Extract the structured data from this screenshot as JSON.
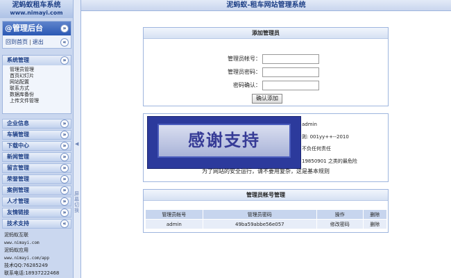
{
  "sidebar": {
    "logo_title": "泥蚂蚁租车系统",
    "logo_url": "www.nimayi.com",
    "admin_title": "@管理后台",
    "home_link": "回到首页",
    "logout_link": "退出",
    "system_group": {
      "label": "系统管理",
      "items": [
        "管理员管理",
        "首页幻灯片",
        "网站配置",
        "联系方式",
        "数据库备份",
        "上传文件管理"
      ]
    },
    "menus": [
      "企业信息",
      "车辆管理",
      "下载中心",
      "新闻管理",
      "留言管理",
      "荣誉管理",
      "案例管理",
      "人才管理",
      "友情链接",
      "技术支持"
    ],
    "info": {
      "line1": "泥蚂蚁互联",
      "line2": "www.nimayi.com",
      "line3": "泥蚂蚁应用",
      "line4": "www.nimayi.com/app",
      "line5": "技术QQ:76285249",
      "line6": "联系电话:18937222468"
    }
  },
  "splitter": {
    "arrow": "◀",
    "label": "屏幕切换"
  },
  "header": {
    "title": "泥蚂蚁-租车网站管理系统"
  },
  "add_admin": {
    "title": "添加管理员",
    "account_label": "管理员帐号：",
    "password_label": "管理员密码：",
    "confirm_label": "密码确认：",
    "submit_label": "确认添加"
  },
  "notice": {
    "banner_text": "感谢支持",
    "line1": "admin",
    "line2": "则: 001yy++--2010",
    "line3": "不负任何责任",
    "line4": "19850901 之类的最危险",
    "footer": "为了网站的安全运行，请不要用复杂，这是基本规则"
  },
  "manage": {
    "title": "管理员帐号管理",
    "columns": [
      "管理员帐号",
      "管理员密码",
      "操作",
      "删除"
    ],
    "rows": [
      {
        "account": "admin",
        "password": "49ba59abbe56e057",
        "action": "修改密码",
        "delete": "删除"
      }
    ]
  },
  "colors": {
    "accent": "#2a58b4",
    "sidebar_bg": "#cad7ef",
    "header_text": "#1d3f86",
    "banner_bg": "#2c3a9c"
  }
}
